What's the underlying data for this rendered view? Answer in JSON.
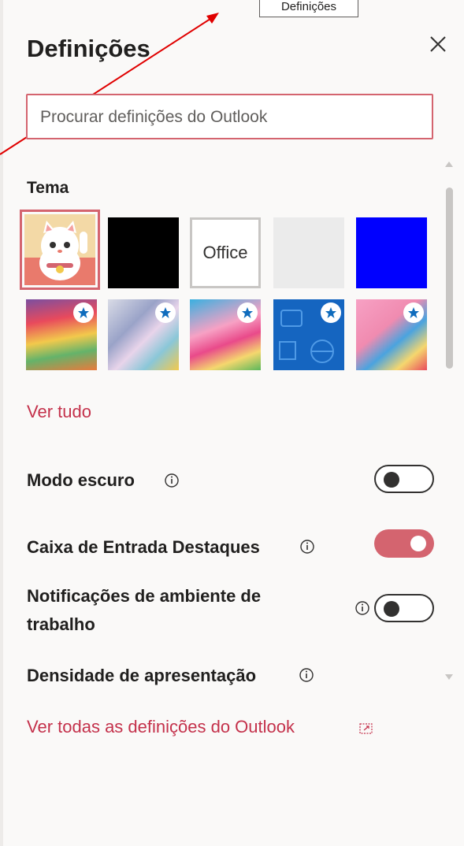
{
  "tooltip": "Definições",
  "panel": {
    "title": "Definições",
    "search_placeholder": "Procurar definições do Outlook"
  },
  "theme": {
    "section_label": "Tema",
    "office_label": "Office",
    "see_all": "Ver tudo"
  },
  "settings": {
    "dark_mode": "Modo escuro",
    "focused_inbox": "Caixa de Entrada Destaques",
    "desktop_notifications": [
      "Notificações de ambiente de",
      "trabalho"
    ],
    "display_density": "Densidade de apresentação",
    "dark_mode_on": false,
    "focused_inbox_on": true,
    "desktop_notifications_on": false
  },
  "footer": {
    "all_settings_link": "Ver todas as definições do Outlook"
  },
  "colors": {
    "accent": "#d4646f",
    "link": "#c4314b",
    "background": "#faf9f8",
    "toggle_off": "#323130"
  },
  "icons": {
    "close": "close-icon",
    "info": "info-icon",
    "star": "star-icon",
    "open_external": "open-in-new-icon"
  }
}
